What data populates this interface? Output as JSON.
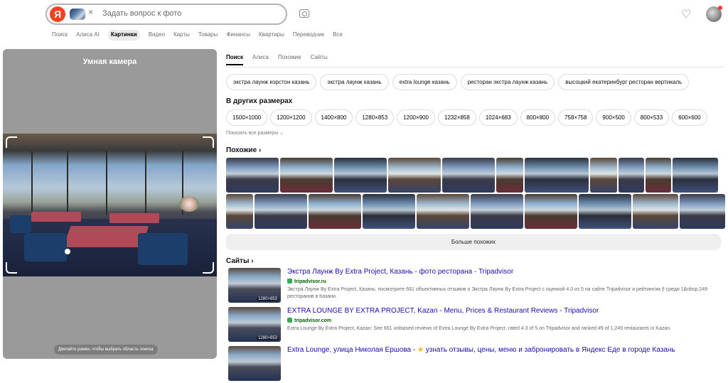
{
  "header": {
    "logo": "Я",
    "search_placeholder": "Задать вопрос к фото",
    "chip_close": "×",
    "icons": [
      "camera-icon",
      "heart-icon",
      "avatar"
    ]
  },
  "nav": {
    "items": [
      "Поиск",
      "Алиса AI",
      "Картинки",
      "Видео",
      "Карты",
      "Товары",
      "Финансы",
      "Квартиры",
      "Переводчик",
      "Все"
    ],
    "active_index": 2
  },
  "smart_camera": {
    "title": "Умная камера",
    "hint": "Двигайте рамки, чтобы выбрать область поиска"
  },
  "tabs": {
    "items": [
      "Поиск",
      "Алиса",
      "Похожие",
      "Сайты"
    ],
    "active_index": 0
  },
  "tags": [
    "экстра лаунж корстон казань",
    "экстра лаунж казань",
    "extra lounge казань",
    "ресторан экстра лаунж казань",
    "высоцкий екатеринбург ресторан вертикаль"
  ],
  "other_sizes": {
    "title": "В других размерах",
    "sizes": [
      "1500×1000",
      "1200×1200",
      "1400×800",
      "1280×853",
      "1200×900",
      "1232×858",
      "1024×683",
      "800×800",
      "758×758",
      "900×500",
      "800×533",
      "600×600"
    ],
    "show_all": "Показать все размеры ⌄"
  },
  "similar": {
    "title": "Похожие ›",
    "more_button": "Больше похожих"
  },
  "sites": {
    "title": "Сайты ›",
    "results": [
      {
        "title": "Экстра Лаунж By Extra Project, Казань - фото ресторана - Tripadvisor",
        "domain": "tripadvisor.ru",
        "snippet": "Экстра Лаунж By Extra Project, Казань: посмотрите 661 объективных отзывов о Экстра Лаунж By Extra Project с оценкой 4.3 из 5 на сайте Tripadvisor и рейтингом 9 среди 1&nbsp;249 ресторанов в Казани.",
        "dims": "1280×853"
      },
      {
        "title": "EXTRA LOUNGE BY EXTRA PROJECT, Kazan - Menu, Prices & Restaurant Reviews - Tripadvisor",
        "domain": "tripadvisor.com",
        "snippet": "Extra Lounge By Extra Project, Kazan: See 661 unbiased reviews of Extra Lounge By Extra Project, rated 4.3 of 5 on Tripadvisor and ranked #9 of 1,249 restaurants in Kazan.",
        "dims": "1280×853"
      },
      {
        "title": "Extra Lounge, улица Николая Ершова - ",
        "star": "★",
        "title_rest": " узнать отзывы, цены, меню и забронировать в Яндекс Еде в городе Казань",
        "domain": "",
        "snippet": "",
        "dims": ""
      }
    ]
  }
}
